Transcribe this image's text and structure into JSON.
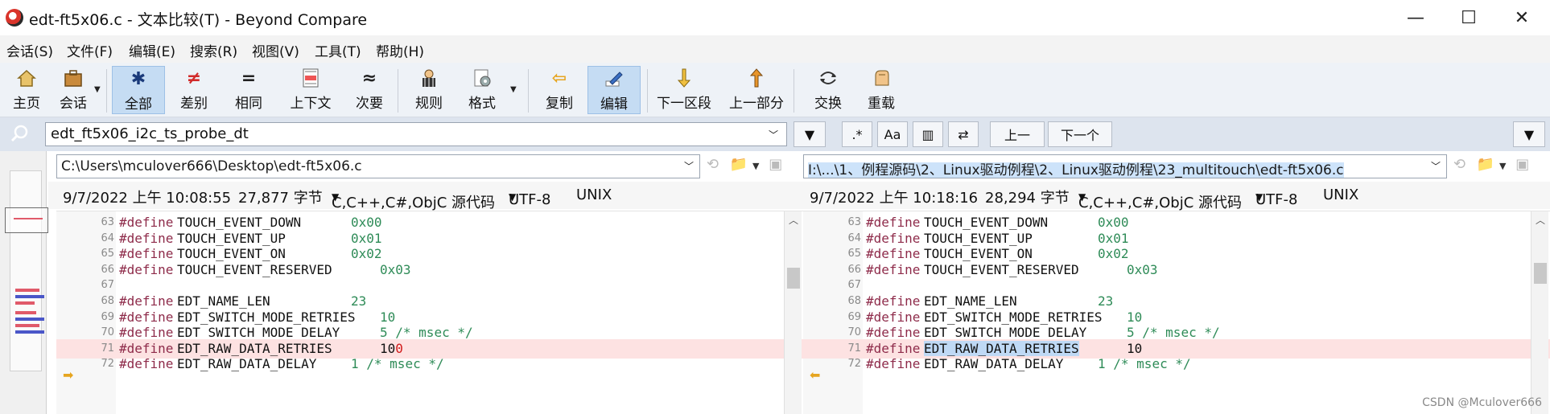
{
  "window": {
    "title": "edt-ft5x06.c - 文本比较(T) - Beyond Compare",
    "minimize": "—",
    "maximize": "☐",
    "close": "✕"
  },
  "menu": [
    "会话(S)",
    "文件(F)",
    "编辑(E)",
    "搜索(R)",
    "视图(V)",
    "工具(T)",
    "帮助(H)"
  ],
  "toolbar": {
    "home": "主页",
    "session": "会话",
    "all": "全部",
    "diffs": "差别",
    "same": "相同",
    "context": "上下文",
    "minor": "次要",
    "rules": "规则",
    "format": "格式",
    "copy": "复制",
    "edit": "编辑",
    "next_section": "下一区段",
    "prev_section": "上一部分",
    "swap": "交换",
    "reload": "重载"
  },
  "search": {
    "value": "edt_ft5x06_i2c_ts_probe_dt",
    "regex": ".*",
    "case": "Aa",
    "prev": "上一",
    "next": "下一个"
  },
  "left": {
    "path": "C:\\Users\\mculover666\\Desktop\\edt-ft5x06.c",
    "date": "9/7/2022 上午 10:08:55",
    "size": "27,877 字节",
    "format": "C,C++,C#,ObjC 源代码",
    "encoding": "UTF-8",
    "eol": "UNIX",
    "lines": [
      {
        "n": "63",
        "name": "TOUCH_EVENT_DOWN",
        "value": "0x00",
        "col": 2
      },
      {
        "n": "64",
        "name": "TOUCH_EVENT_UP",
        "value": "0x01",
        "col": 2
      },
      {
        "n": "65",
        "name": "TOUCH_EVENT_ON",
        "value": "0x02",
        "col": 2
      },
      {
        "n": "66",
        "name": "TOUCH_EVENT_RESERVED",
        "value": "0x03",
        "col": 3
      },
      {
        "n": "67",
        "name": "",
        "value": "",
        "col": 0
      },
      {
        "n": "68",
        "name": "EDT_NAME_LEN",
        "value": "23",
        "col": 2
      },
      {
        "n": "69",
        "name": "EDT_SWITCH_MODE_RETRIES",
        "value": "10",
        "col": 3
      },
      {
        "n": "70",
        "name": "EDT_SWITCH_MODE_DELAY",
        "value": "5",
        "comment": "/* msec */",
        "col": 3
      },
      {
        "n": "71",
        "name": "EDT_RAW_DATA_RETRIES",
        "value": "10",
        "value_diff": "0",
        "col": 3
      },
      {
        "n": "72",
        "name": "EDT_RAW_DATA_DELAY",
        "value": "1",
        "comment": "/* msec */",
        "col": 2
      }
    ]
  },
  "right": {
    "path": "I:\\...\\1、例程源码\\2、Linux驱动例程\\2、Linux驱动例程\\23_multitouch\\edt-ft5x06.c",
    "date": "9/7/2022 上午 10:18:16",
    "size": "28,294 字节",
    "format": "C,C++,C#,ObjC 源代码",
    "encoding": "UTF-8",
    "eol": "UNIX"
  },
  "define_kw": "#define",
  "watermark": "CSDN @Mculover666"
}
